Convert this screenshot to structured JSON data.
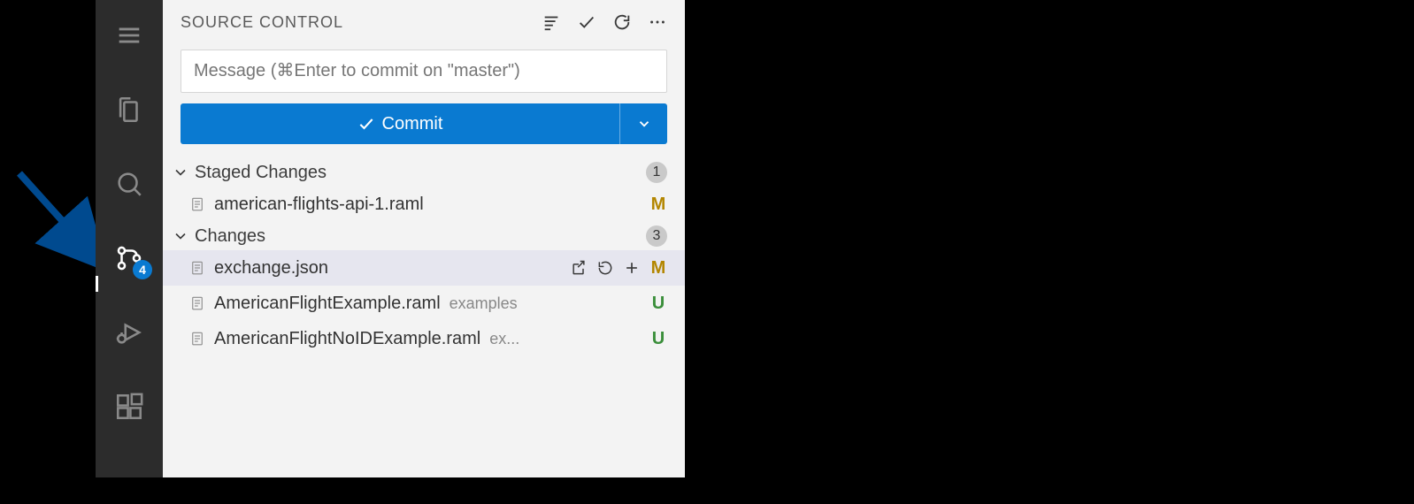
{
  "activityBar": {
    "scmBadge": "4"
  },
  "sidebar": {
    "title": "SOURCE CONTROL",
    "commitPlaceholder": "Message (⌘Enter to commit on \"master\")",
    "commitButton": "Commit",
    "sections": {
      "staged": {
        "label": "Staged Changes",
        "count": "1",
        "items": [
          {
            "name": "american-flights-api-1.raml",
            "path": "",
            "status": "M"
          }
        ]
      },
      "changes": {
        "label": "Changes",
        "count": "3",
        "items": [
          {
            "name": "exchange.json",
            "path": "",
            "status": "M",
            "selected": true,
            "actions": true
          },
          {
            "name": "AmericanFlightExample.raml",
            "path": "examples",
            "status": "U"
          },
          {
            "name": "AmericanFlightNoIDExample.raml",
            "path": "ex...",
            "status": "U"
          }
        ]
      }
    }
  }
}
